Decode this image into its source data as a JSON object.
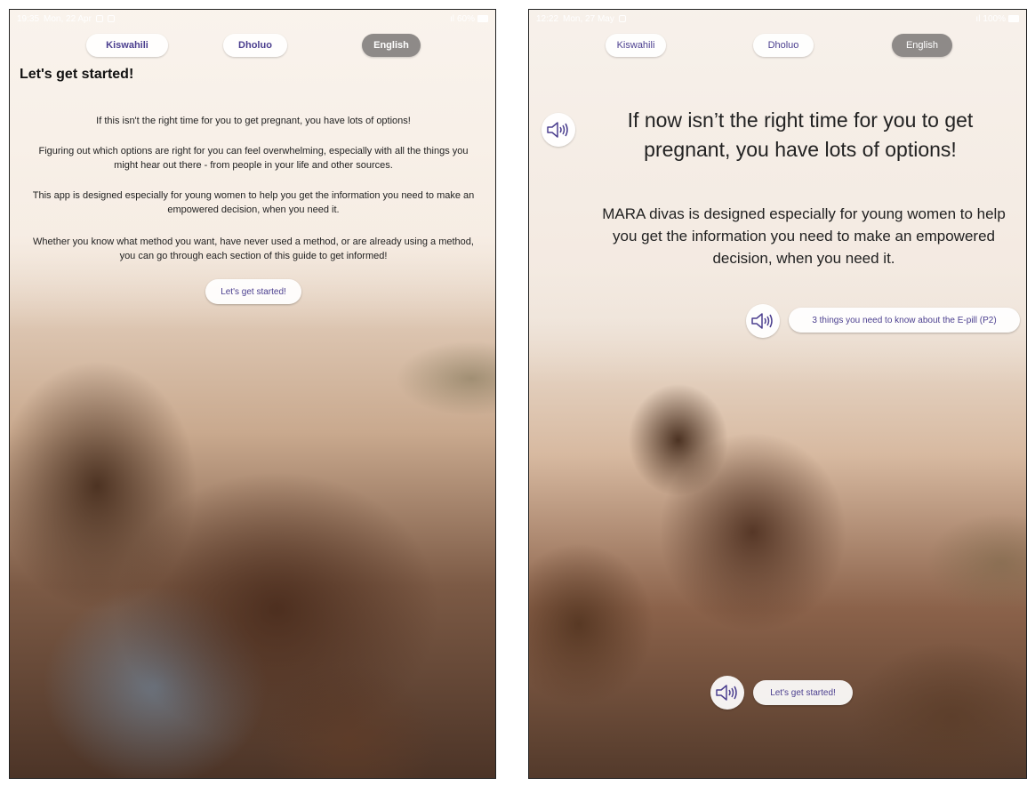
{
  "left_screen": {
    "status_time": "19:35",
    "status_date": "Mon, 22 Apr",
    "status_battery": "60%",
    "languages": [
      "Kiswahili",
      "Dholuo",
      "English"
    ],
    "active_language": "English",
    "heading": "Let's get started!",
    "paragraphs": [
      "If this isn't the right time for you to get pregnant, you have lots of options!",
      "Figuring out which options are right for you can feel overwhelming, especially with all the things you might hear out there - from people in your life and other sources.",
      "This app is designed especially for young women to help you get the information you need to make an empowered decision, when you need it.",
      "Whether you know what method you want, have never used a method, or are already using a method, you can go through each section of this guide to get informed!"
    ],
    "start_button": "Let's get started!"
  },
  "right_screen": {
    "status_time": "12:22",
    "status_date": "Mon, 27 May",
    "status_battery": "100%",
    "languages": [
      "Kiswahili",
      "Dholuo",
      "English"
    ],
    "active_language": "English",
    "title": "If now isn’t the right time for you to get pregnant, you have lots of options!",
    "paragraph": "MARA divas is designed especially for young women to help you get the information you need to make an empowered decision, when you need it.",
    "link_button": "3 things you need to know about the E-pill (P2)",
    "start_button": "Let's get started!"
  },
  "icons": {
    "speaker": "speaker-icon",
    "battery": "battery-icon",
    "signal": "signal-icon"
  },
  "colors": {
    "accent_text": "#4b3f8f",
    "active_language_bg": "#8e8a88"
  }
}
